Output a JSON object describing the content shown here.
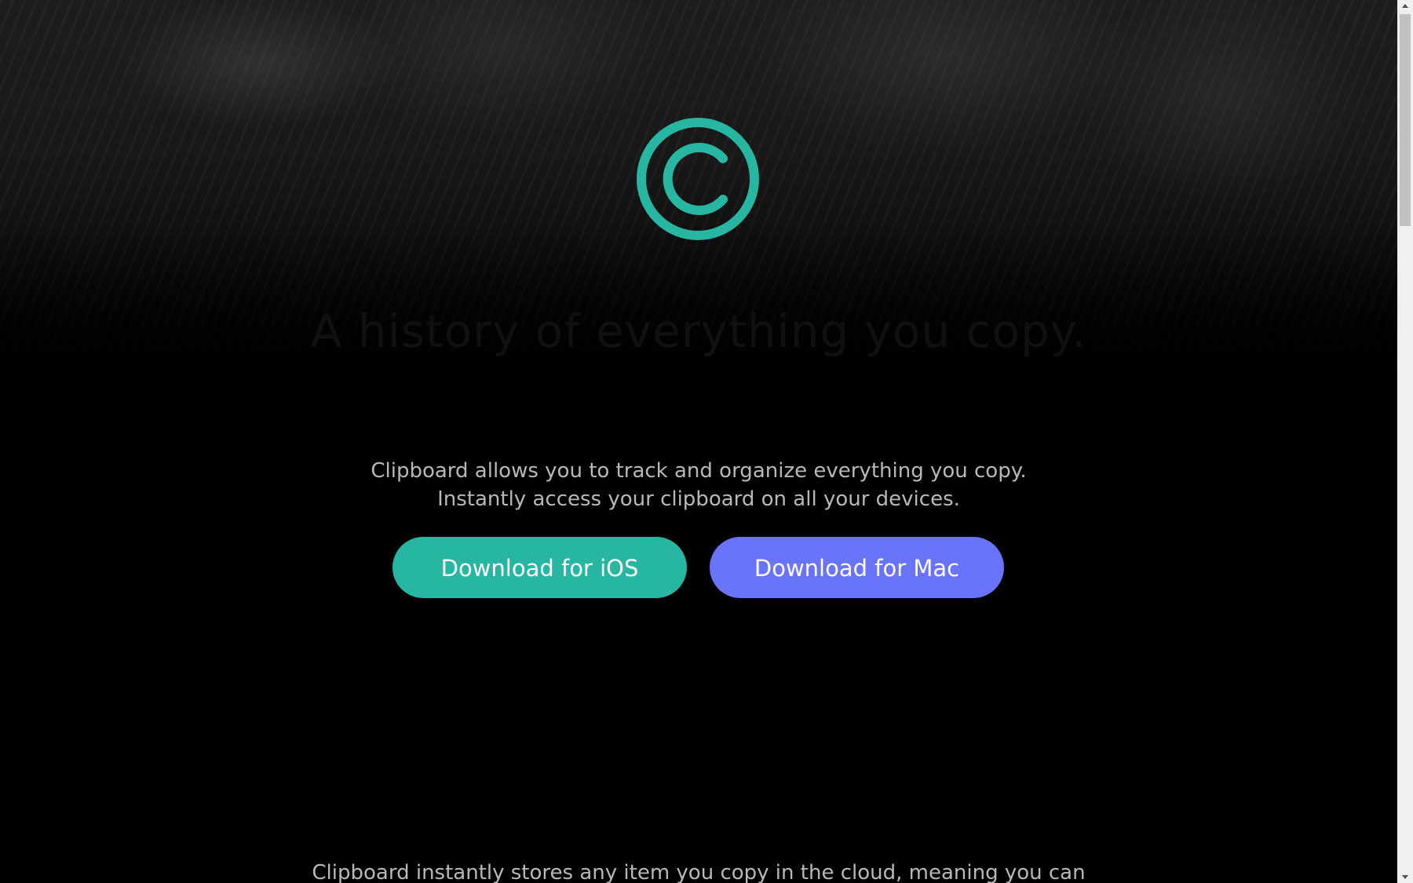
{
  "hero": {
    "logo_icon": "copyright-c-icon",
    "headline": "A history of everything you copy.",
    "tagline_line1": "Clipboard allows you to track and organize everything you copy.",
    "tagline_line2": "Instantly access your clipboard on all your devices."
  },
  "buttons": {
    "ios_label": "Download for iOS",
    "mac_label": "Download for Mac"
  },
  "features": {
    "intro_text": "Clipboard instantly stores any item you copy in the cloud, meaning you can"
  },
  "colors": {
    "accent_teal": "#27b6a1",
    "accent_indigo": "#6a74fb",
    "background": "#000000",
    "body_text": "#b8b8b8"
  }
}
